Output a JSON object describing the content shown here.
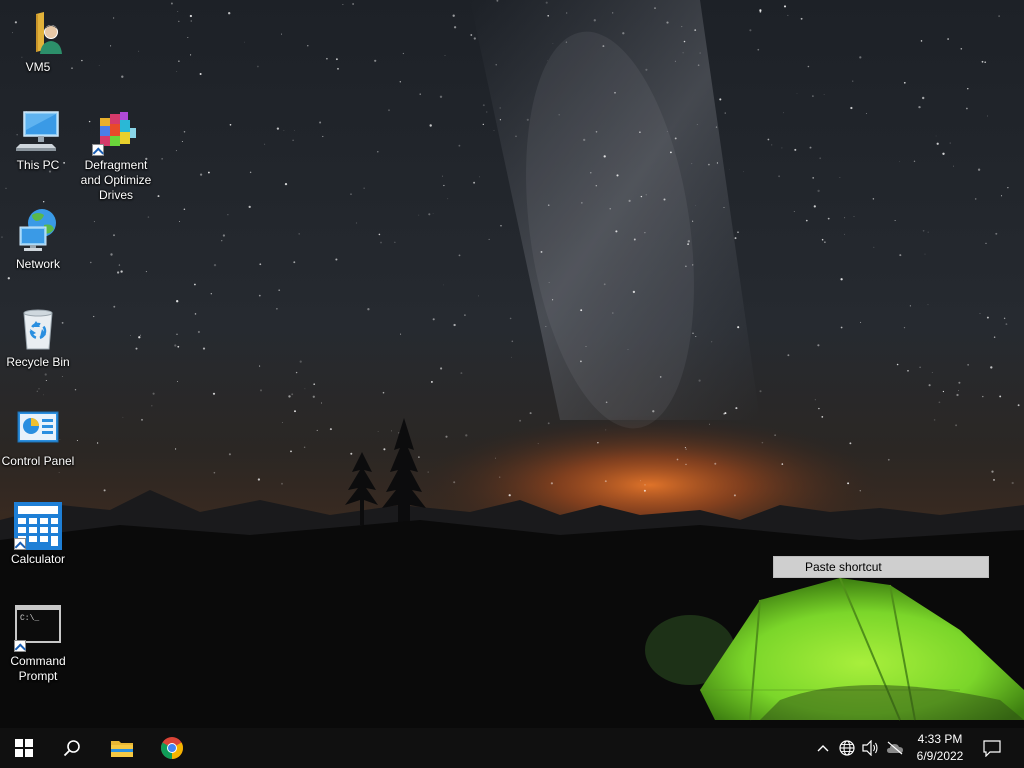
{
  "desktop": {
    "icons": [
      {
        "label": "VM5",
        "icon": "user-folder-icon"
      },
      {
        "label": "This PC",
        "icon": "computer-icon"
      },
      {
        "label": "Defragment and Optimize Drives",
        "icon": "defrag-icon",
        "shortcut": true
      },
      {
        "label": "Network",
        "icon": "network-icon"
      },
      {
        "label": "Recycle Bin",
        "icon": "recycle-bin-icon"
      },
      {
        "label": "Control Panel",
        "icon": "control-panel-icon"
      },
      {
        "label": "Calculator",
        "icon": "calculator-icon",
        "shortcut": true
      },
      {
        "label": "Command Prompt",
        "icon": "command-prompt-icon",
        "shortcut": true
      }
    ]
  },
  "context_menu": {
    "items": [
      {
        "label": "Paste shortcut"
      }
    ]
  },
  "taskbar": {
    "buttons": [
      "start-icon",
      "search-icon",
      "file-explorer-icon",
      "chrome-icon"
    ],
    "tray": [
      "chevron-up-icon",
      "globe-network-icon",
      "speaker-icon",
      "onedrive-offline-icon"
    ],
    "clock": {
      "time": "4:33 PM",
      "date": "6/9/2022"
    },
    "notifications": "action-center-icon"
  },
  "colors": {
    "taskbar": "#101010",
    "tent": "#7bd62a",
    "menu": "#cfcfcf"
  }
}
